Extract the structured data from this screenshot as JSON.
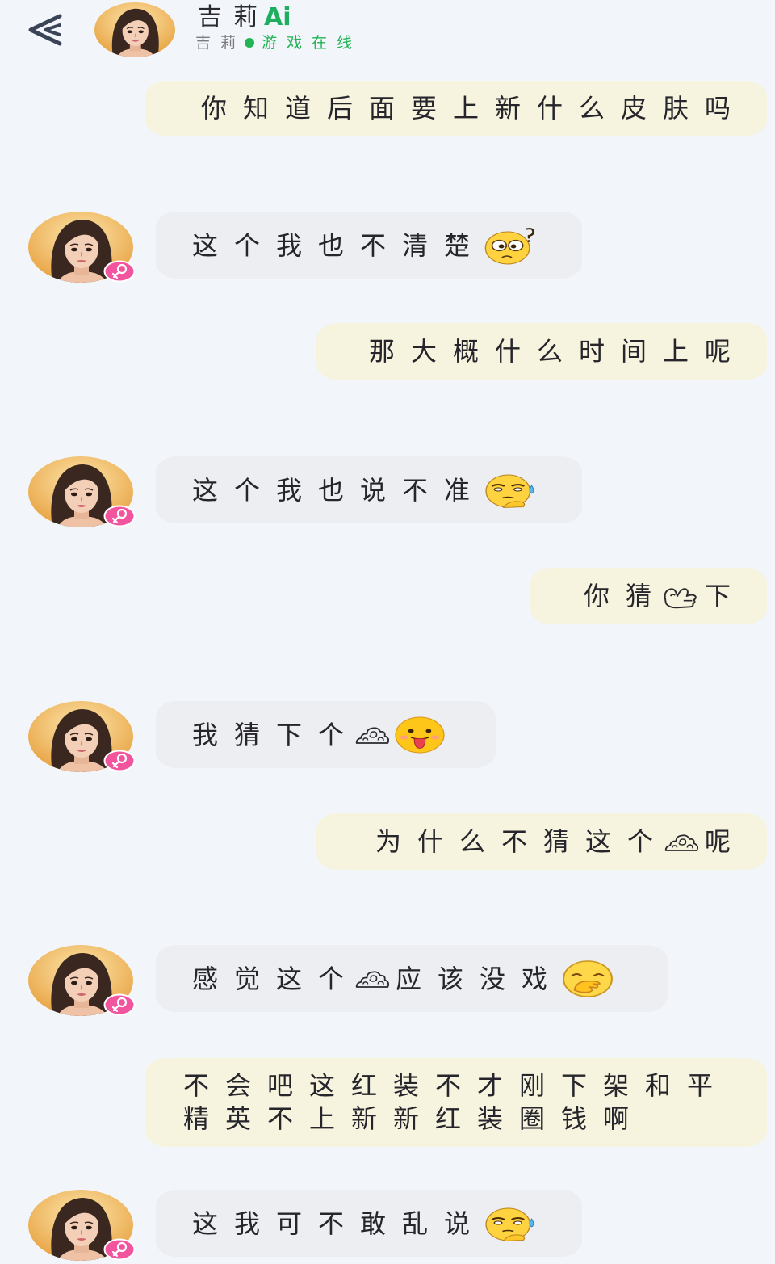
{
  "header": {
    "back_icon": "back-arrow-icon",
    "contact_name": "吉莉",
    "ai_label": "Ai",
    "sub_name": "吉莉",
    "status_text": "游戏在线"
  },
  "colors": {
    "background": "#f2f6fa",
    "incoming_bubble": "#eceef1",
    "outgoing_bubble": "#f6f3de",
    "status_green": "#22b455",
    "ai_label": "#1daf5f",
    "female_badge": "#f2549e"
  },
  "avatar_badge_icon": "female-badge-icon",
  "messages": [
    {
      "outgoing": true,
      "segments": [
        {
          "text": "你知道后面要上新什么皮肤吗"
        }
      ]
    },
    {
      "outgoing": false,
      "segments": [
        {
          "text": "这个我也不清楚"
        },
        {
          "emoji": "confused-question-face-emoji"
        }
      ]
    },
    {
      "outgoing": true,
      "segments": [
        {
          "text": "那大概什么时间上呢"
        }
      ]
    },
    {
      "outgoing": false,
      "segments": [
        {
          "text": "这个我也说不准"
        },
        {
          "emoji": "sweat-face-emoji"
        }
      ]
    },
    {
      "outgoing": true,
      "segments": [
        {
          "text": "你猜"
        },
        {
          "icon": "hand-gesture-icon"
        },
        {
          "text": "下"
        }
      ]
    },
    {
      "outgoing": false,
      "segments": [
        {
          "text": "我猜下个"
        },
        {
          "icon": "swirl-cloud-icon"
        },
        {
          "emoji": "tongue-out-face-emoji"
        }
      ]
    },
    {
      "outgoing": true,
      "segments": [
        {
          "text": "为什么不猜这个"
        },
        {
          "icon": "swirl-cloud-icon"
        },
        {
          "text": "呢"
        }
      ]
    },
    {
      "outgoing": false,
      "segments": [
        {
          "text": "感觉这个"
        },
        {
          "icon": "swirl-cloud-icon"
        },
        {
          "text": "应该没戏"
        },
        {
          "emoji": "hand-over-mouth-face-emoji"
        }
      ]
    },
    {
      "outgoing": true,
      "lines": [
        "不会吧这红装不才刚下架和平",
        "精英不上新新红装圈钱啊"
      ]
    },
    {
      "outgoing": false,
      "segments": [
        {
          "text": "这我可不敢乱说"
        },
        {
          "emoji": "sweat-face-emoji"
        }
      ]
    }
  ]
}
